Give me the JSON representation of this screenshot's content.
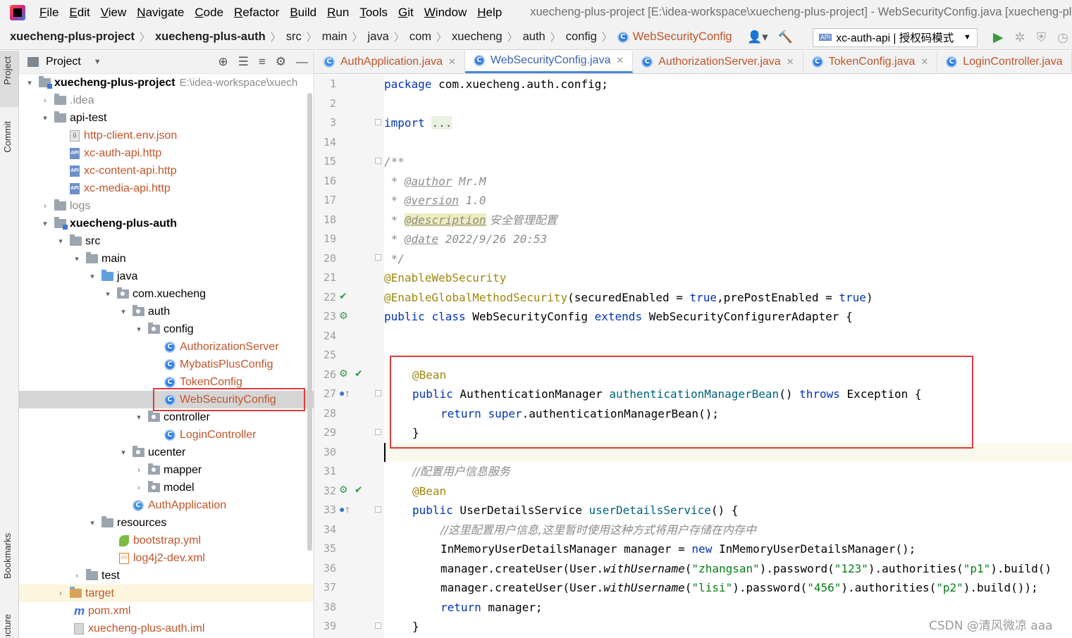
{
  "menu": {
    "items": [
      {
        "u": "F",
        "rest": "ile"
      },
      {
        "u": "E",
        "rest": "dit"
      },
      {
        "u": "V",
        "rest": "iew"
      },
      {
        "u": "N",
        "rest": "avigate"
      },
      {
        "u": "C",
        "rest": "ode"
      },
      {
        "u": "R",
        "rest": "efactor"
      },
      {
        "u": "B",
        "rest": "uild"
      },
      {
        "u": "R",
        "rest": "un"
      },
      {
        "u": "T",
        "rest": "ools"
      },
      {
        "u": "G",
        "rest": "it"
      },
      {
        "u": "W",
        "rest": "indow"
      },
      {
        "u": "H",
        "rest": "elp"
      }
    ],
    "window_title": "xuecheng-plus-project [E:\\idea-workspace\\xuecheng-plus-project] - WebSecurityConfig.java [xuecheng-plu"
  },
  "breadcrumb": [
    "xuecheng-plus-project",
    "xuecheng-plus-auth",
    "src",
    "main",
    "java",
    "com",
    "xuecheng",
    "auth",
    "config",
    "WebSecurityConfig"
  ],
  "run_config": {
    "name": "xc-auth-api | 授权码模式",
    "icon_text": "API"
  },
  "side_tabs": {
    "project": "Project",
    "commit": "Commit",
    "bookmarks": "Bookmarks",
    "structure": "ıcture"
  },
  "project_panel": {
    "title": "Project",
    "tree": [
      {
        "label": "xuecheng-plus-project",
        "extra": "E:\\idea-workspace\\xuech"
      },
      {
        "label": ".idea"
      },
      {
        "label": "api-test"
      },
      {
        "label": "http-client.env.json"
      },
      {
        "label": "xc-auth-api.http"
      },
      {
        "label": "xc-content-api.http"
      },
      {
        "label": "xc-media-api.http"
      },
      {
        "label": "logs"
      },
      {
        "label": "xuecheng-plus-auth"
      },
      {
        "label": "src"
      },
      {
        "label": "main"
      },
      {
        "label": "java"
      },
      {
        "label": "com.xuecheng"
      },
      {
        "label": "auth"
      },
      {
        "label": "config"
      },
      {
        "label": "AuthorizationServer"
      },
      {
        "label": "MybatisPlusConfig"
      },
      {
        "label": "TokenConfig"
      },
      {
        "label": "WebSecurityConfig"
      },
      {
        "label": "controller"
      },
      {
        "label": "LoginController"
      },
      {
        "label": "ucenter"
      },
      {
        "label": "mapper"
      },
      {
        "label": "model"
      },
      {
        "label": "AuthApplication"
      },
      {
        "label": "resources"
      },
      {
        "label": "bootstrap.yml"
      },
      {
        "label": "log4j2-dev.xml"
      },
      {
        "label": "test"
      },
      {
        "label": "target"
      },
      {
        "label": "pom.xml"
      },
      {
        "label": "xuecheng-plus-auth.iml"
      }
    ],
    "icon_text": {
      "api": "API",
      "json": "{}",
      "xml": "</>",
      "maven": "m"
    }
  },
  "editor_tabs": [
    {
      "label": "AuthApplication.java"
    },
    {
      "label": "WebSecurityConfig.java"
    },
    {
      "label": "AuthorizationServer.java"
    },
    {
      "label": "TokenConfig.java"
    },
    {
      "label": "LoginController.java"
    }
  ],
  "gutter": {
    "line_numbers": [
      "1",
      "2",
      "3",
      "14",
      "15",
      "16",
      "17",
      "18",
      "19",
      "20",
      "21",
      "22",
      "23",
      "24",
      "25",
      "26",
      "27",
      "28",
      "29",
      "30",
      "31",
      "32",
      "33",
      "34",
      "35",
      "36",
      "37",
      "38",
      "39"
    ],
    "class_icon_letter": "C"
  },
  "code": {
    "l1": {
      "kw": "package",
      "rest": " com.xuecheng.auth.config;"
    },
    "l3": {
      "kw": "import",
      "fold": "..."
    },
    "l15": "/**",
    "l16": {
      "pre": " * ",
      "tag": "@author",
      "val": " Mr.M"
    },
    "l17": {
      "pre": " * ",
      "tag": "@version",
      "val": " 1.0"
    },
    "l18": {
      "pre": " * ",
      "tag": "@description",
      "val": " 安全管理配置"
    },
    "l19": {
      "pre": " * ",
      "tag": "@date",
      "val": " 2022/9/26 20:53"
    },
    "l20": " */",
    "l21": "@EnableWebSecurity",
    "l22": {
      "ann": "@EnableGlobalMethodSecurity",
      "p1": "(securedEnabled = ",
      "v1": "true",
      "p2": ",prePostEnabled = ",
      "v2": "true",
      "p3": ")"
    },
    "l23": {
      "k1": "public",
      "k2": "class",
      "name": " WebSecurityConfig ",
      "k3": "extends",
      "rest": " WebSecurityConfigurerAdapter {"
    },
    "l26": "@Bean",
    "l27": {
      "k1": "public",
      "type": " AuthenticationManager ",
      "fn": "authenticationManagerBean",
      "p": "() ",
      "k2": "throws",
      "rest": " Exception {"
    },
    "l28": {
      "k1": "return",
      "k2": "super",
      "rest": ".authenticationManagerBean();"
    },
    "l29": "}",
    "l31": "//配置用户信息服务",
    "l32": "@Bean",
    "l33": {
      "k1": "public",
      "type": " UserDetailsService ",
      "fn": "userDetailsService",
      "rest": "() {"
    },
    "l34": "//这里配置用户信息,这里暂时使用这种方式将用户存储在内存中",
    "l35": {
      "pre": "InMemoryUserDetailsManager manager = ",
      "k": "new",
      "rest": " InMemoryUserDetailsManager();"
    },
    "l36": {
      "a": "manager.createUser(User.",
      "b": "withUsername",
      "c": "(",
      "s1": "\"zhangsan\"",
      "d": ").password(",
      "s2": "\"123\"",
      "e": ").authorities(",
      "s3": "\"p1\"",
      "f": ").build()"
    },
    "l37": {
      "a": "manager.createUser(User.",
      "b": "withUsername",
      "c": "(",
      "s1": "\"lisi\"",
      "d": ").password(",
      "s2": "\"456\"",
      "e": ").authorities(",
      "s3": "\"p2\"",
      "f": ").build());"
    },
    "l38": {
      "k": "return",
      "rest": " manager;"
    },
    "l39": "}"
  },
  "watermark": "CSDN @清风微凉 aaa",
  "colors": {
    "highlight_box": "#e03a3a",
    "keyword": "#0033b3",
    "annotation": "#9e880d",
    "string": "#067d17",
    "active_tab": "#4a88d9"
  }
}
